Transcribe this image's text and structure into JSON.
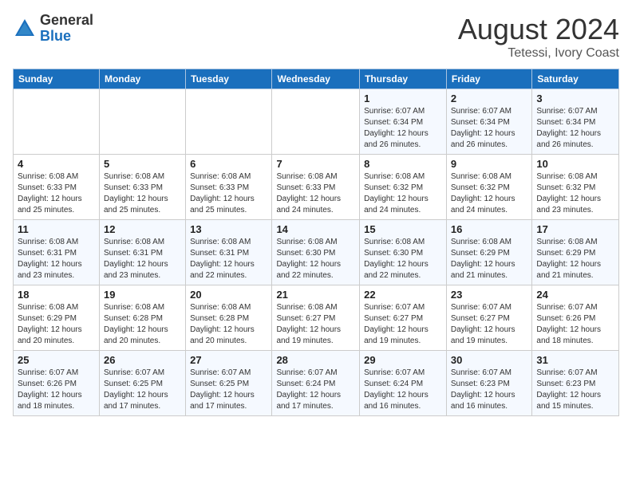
{
  "logo": {
    "general": "General",
    "blue": "Blue"
  },
  "title": "August 2024",
  "subtitle": "Tetessi, Ivory Coast",
  "days_of_week": [
    "Sunday",
    "Monday",
    "Tuesday",
    "Wednesday",
    "Thursday",
    "Friday",
    "Saturday"
  ],
  "weeks": [
    [
      {
        "day": "",
        "info": ""
      },
      {
        "day": "",
        "info": ""
      },
      {
        "day": "",
        "info": ""
      },
      {
        "day": "",
        "info": ""
      },
      {
        "day": "1",
        "info": "Sunrise: 6:07 AM\nSunset: 6:34 PM\nDaylight: 12 hours\nand 26 minutes."
      },
      {
        "day": "2",
        "info": "Sunrise: 6:07 AM\nSunset: 6:34 PM\nDaylight: 12 hours\nand 26 minutes."
      },
      {
        "day": "3",
        "info": "Sunrise: 6:07 AM\nSunset: 6:34 PM\nDaylight: 12 hours\nand 26 minutes."
      }
    ],
    [
      {
        "day": "4",
        "info": "Sunrise: 6:08 AM\nSunset: 6:33 PM\nDaylight: 12 hours\nand 25 minutes."
      },
      {
        "day": "5",
        "info": "Sunrise: 6:08 AM\nSunset: 6:33 PM\nDaylight: 12 hours\nand 25 minutes."
      },
      {
        "day": "6",
        "info": "Sunrise: 6:08 AM\nSunset: 6:33 PM\nDaylight: 12 hours\nand 25 minutes."
      },
      {
        "day": "7",
        "info": "Sunrise: 6:08 AM\nSunset: 6:33 PM\nDaylight: 12 hours\nand 24 minutes."
      },
      {
        "day": "8",
        "info": "Sunrise: 6:08 AM\nSunset: 6:32 PM\nDaylight: 12 hours\nand 24 minutes."
      },
      {
        "day": "9",
        "info": "Sunrise: 6:08 AM\nSunset: 6:32 PM\nDaylight: 12 hours\nand 24 minutes."
      },
      {
        "day": "10",
        "info": "Sunrise: 6:08 AM\nSunset: 6:32 PM\nDaylight: 12 hours\nand 23 minutes."
      }
    ],
    [
      {
        "day": "11",
        "info": "Sunrise: 6:08 AM\nSunset: 6:31 PM\nDaylight: 12 hours\nand 23 minutes."
      },
      {
        "day": "12",
        "info": "Sunrise: 6:08 AM\nSunset: 6:31 PM\nDaylight: 12 hours\nand 23 minutes."
      },
      {
        "day": "13",
        "info": "Sunrise: 6:08 AM\nSunset: 6:31 PM\nDaylight: 12 hours\nand 22 minutes."
      },
      {
        "day": "14",
        "info": "Sunrise: 6:08 AM\nSunset: 6:30 PM\nDaylight: 12 hours\nand 22 minutes."
      },
      {
        "day": "15",
        "info": "Sunrise: 6:08 AM\nSunset: 6:30 PM\nDaylight: 12 hours\nand 22 minutes."
      },
      {
        "day": "16",
        "info": "Sunrise: 6:08 AM\nSunset: 6:29 PM\nDaylight: 12 hours\nand 21 minutes."
      },
      {
        "day": "17",
        "info": "Sunrise: 6:08 AM\nSunset: 6:29 PM\nDaylight: 12 hours\nand 21 minutes."
      }
    ],
    [
      {
        "day": "18",
        "info": "Sunrise: 6:08 AM\nSunset: 6:29 PM\nDaylight: 12 hours\nand 20 minutes."
      },
      {
        "day": "19",
        "info": "Sunrise: 6:08 AM\nSunset: 6:28 PM\nDaylight: 12 hours\nand 20 minutes."
      },
      {
        "day": "20",
        "info": "Sunrise: 6:08 AM\nSunset: 6:28 PM\nDaylight: 12 hours\nand 20 minutes."
      },
      {
        "day": "21",
        "info": "Sunrise: 6:08 AM\nSunset: 6:27 PM\nDaylight: 12 hours\nand 19 minutes."
      },
      {
        "day": "22",
        "info": "Sunrise: 6:07 AM\nSunset: 6:27 PM\nDaylight: 12 hours\nand 19 minutes."
      },
      {
        "day": "23",
        "info": "Sunrise: 6:07 AM\nSunset: 6:27 PM\nDaylight: 12 hours\nand 19 minutes."
      },
      {
        "day": "24",
        "info": "Sunrise: 6:07 AM\nSunset: 6:26 PM\nDaylight: 12 hours\nand 18 minutes."
      }
    ],
    [
      {
        "day": "25",
        "info": "Sunrise: 6:07 AM\nSunset: 6:26 PM\nDaylight: 12 hours\nand 18 minutes."
      },
      {
        "day": "26",
        "info": "Sunrise: 6:07 AM\nSunset: 6:25 PM\nDaylight: 12 hours\nand 17 minutes."
      },
      {
        "day": "27",
        "info": "Sunrise: 6:07 AM\nSunset: 6:25 PM\nDaylight: 12 hours\nand 17 minutes."
      },
      {
        "day": "28",
        "info": "Sunrise: 6:07 AM\nSunset: 6:24 PM\nDaylight: 12 hours\nand 17 minutes."
      },
      {
        "day": "29",
        "info": "Sunrise: 6:07 AM\nSunset: 6:24 PM\nDaylight: 12 hours\nand 16 minutes."
      },
      {
        "day": "30",
        "info": "Sunrise: 6:07 AM\nSunset: 6:23 PM\nDaylight: 12 hours\nand 16 minutes."
      },
      {
        "day": "31",
        "info": "Sunrise: 6:07 AM\nSunset: 6:23 PM\nDaylight: 12 hours\nand 15 minutes."
      }
    ]
  ]
}
